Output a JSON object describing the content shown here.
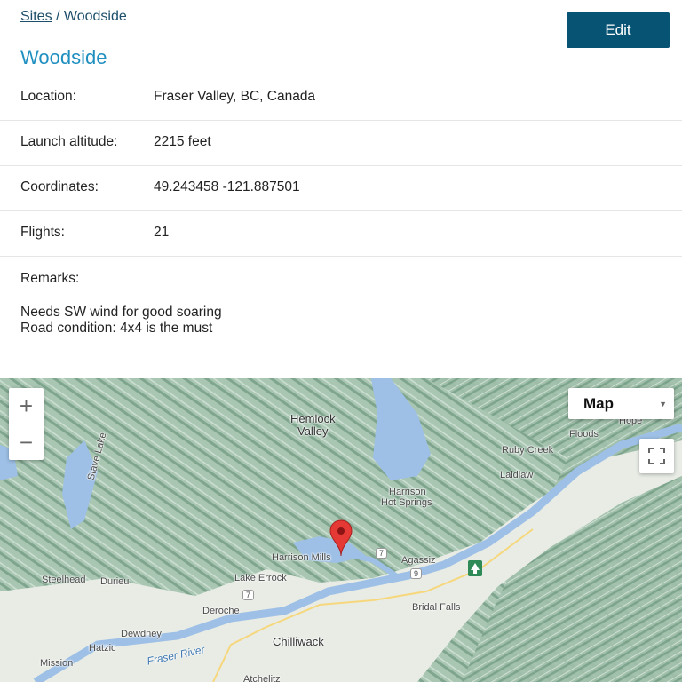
{
  "breadcrumb": {
    "parent": "Sites",
    "separator": " / ",
    "current": "Woodside"
  },
  "toolbar": {
    "edit_label": "Edit"
  },
  "site": {
    "title": "Woodside",
    "fields": [
      {
        "label": "Location:",
        "value": "Fraser Valley, BC, Canada"
      },
      {
        "label": "Launch altitude:",
        "value": "2215 feet"
      },
      {
        "label": "Coordinates:",
        "value": "49.243458 -121.887501"
      },
      {
        "label": "Flights:",
        "value": "21"
      }
    ],
    "remarks_label": "Remarks:",
    "remarks_lines": [
      "Needs SW wind for good soaring",
      "Road condition: 4x4 is the must"
    ]
  },
  "map": {
    "zoom_in": "+",
    "zoom_out": "−",
    "type_label": "Map",
    "labels": {
      "hemlock": "Hemlock",
      "valley": "Valley",
      "stave_lake": "Stave Lake",
      "hope": "Hope",
      "floods": "Floods",
      "ruby_creek": "Ruby Creek",
      "laidlaw": "Laidlaw",
      "harrison": "Harrison",
      "hot_springs": "Hot Springs",
      "harrison_mills": "Harrison Mills",
      "agassiz": "Agassiz",
      "steelhead": "Steelhead",
      "durieu": "Durieu",
      "lake_errock": "Lake Errock",
      "deroche": "Deroche",
      "bridal_falls": "Bridal Falls",
      "dewdney": "Dewdney",
      "chilliwack": "Chilliwack",
      "hatzic": "Hatzic",
      "mission": "Mission",
      "fraser_river": "Fraser River",
      "atchelitz": "Atchelitz",
      "route_7a": "7",
      "route_7b": "7",
      "route_9": "9"
    },
    "colors": {
      "water": "#9ec0e6",
      "terrain": "#a9c7b4",
      "valley": "#e9ece6",
      "marker": "#e53935"
    }
  }
}
